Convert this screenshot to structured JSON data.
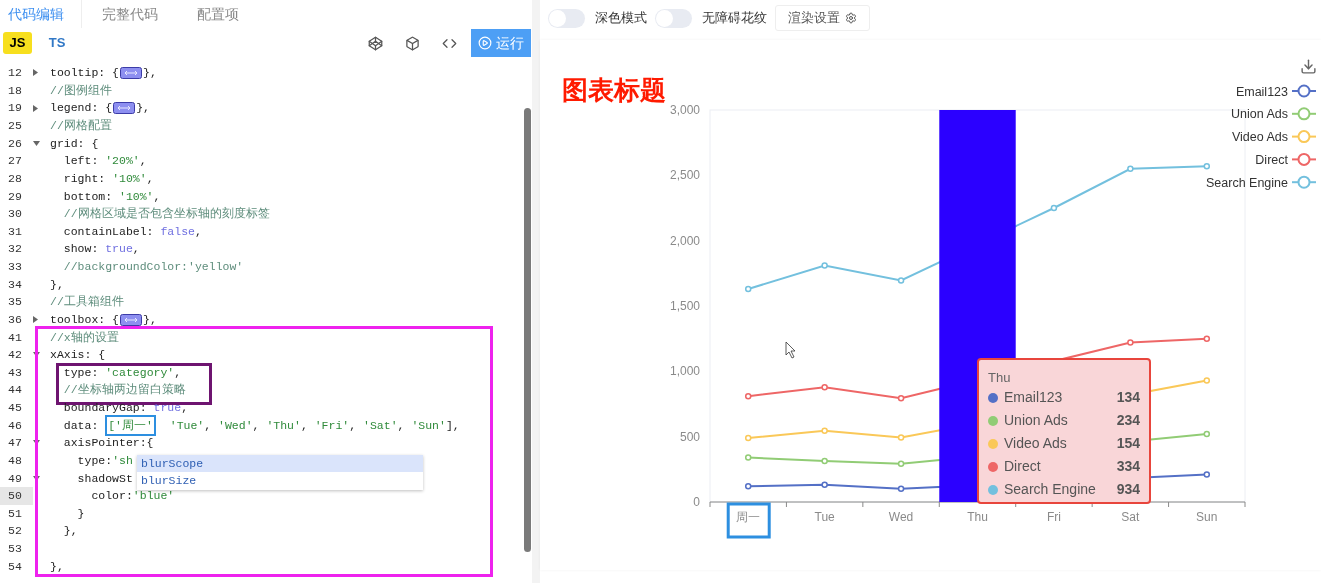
{
  "left_tabs": [
    {
      "label": "代码编辑",
      "selected": true
    },
    {
      "label": "完整代码",
      "selected": false
    },
    {
      "label": "配置项",
      "selected": false
    }
  ],
  "editor": {
    "languages": [
      {
        "label": "JS",
        "selected": true
      },
      {
        "label": "TS",
        "selected": false
      }
    ],
    "run_button": "运行",
    "blocks": [
      {
        "kind": "line",
        "number": "12",
        "fold_open": false,
        "tokens": [
          {
            "kind": "plain",
            "text": "tooltip: {"
          },
          {
            "kind": "fold"
          },
          {
            "kind": "plain",
            "text": "},"
          }
        ]
      },
      {
        "kind": "line",
        "number": "18",
        "tokens": [
          {
            "kind": "comment",
            "text": "//图例组件"
          }
        ]
      },
      {
        "kind": "line",
        "number": "19",
        "fold_open": false,
        "tokens": [
          {
            "kind": "plain",
            "text": "legend: {"
          },
          {
            "kind": "fold"
          },
          {
            "kind": "plain",
            "text": "},"
          }
        ]
      },
      {
        "kind": "line",
        "number": "25",
        "tokens": [
          {
            "kind": "comment",
            "text": "//网格配置"
          }
        ]
      },
      {
        "kind": "line",
        "number": "26",
        "fold_open": true,
        "tokens": [
          {
            "kind": "plain",
            "text": "grid: {"
          }
        ]
      },
      {
        "kind": "line",
        "number": "27",
        "tokens": [
          {
            "kind": "plain",
            "text": "  left: "
          },
          {
            "kind": "string",
            "text": "'20%'"
          },
          {
            "kind": "plain",
            "text": ","
          }
        ]
      },
      {
        "kind": "line",
        "number": "28",
        "tokens": [
          {
            "kind": "plain",
            "text": "  right: "
          },
          {
            "kind": "string",
            "text": "'10%'"
          },
          {
            "kind": "plain",
            "text": ","
          }
        ]
      },
      {
        "kind": "line",
        "number": "29",
        "tokens": [
          {
            "kind": "plain",
            "text": "  bottom: "
          },
          {
            "kind": "string",
            "text": "'10%'"
          },
          {
            "kind": "plain",
            "text": ","
          }
        ]
      },
      {
        "kind": "line",
        "number": "30",
        "tokens": [
          {
            "kind": "comment",
            "text": "  //网格区域是否包含坐标轴的刻度标签"
          }
        ]
      },
      {
        "kind": "line",
        "number": "31",
        "tokens": [
          {
            "kind": "plain",
            "text": "  containLabel: "
          },
          {
            "kind": "keyword",
            "text": "false"
          },
          {
            "kind": "plain",
            "text": ","
          }
        ]
      },
      {
        "kind": "line",
        "number": "32",
        "tokens": [
          {
            "kind": "plain",
            "text": "  show: "
          },
          {
            "kind": "keyword",
            "text": "true"
          },
          {
            "kind": "plain",
            "text": ","
          }
        ]
      },
      {
        "kind": "line",
        "number": "33",
        "tokens": [
          {
            "kind": "comment",
            "text": "  //backgroundColor:'yellow'"
          }
        ]
      },
      {
        "kind": "line",
        "number": "34",
        "tokens": [
          {
            "kind": "plain",
            "text": "},"
          }
        ]
      },
      {
        "kind": "line",
        "number": "35",
        "tokens": [
          {
            "kind": "comment",
            "text": "//工具箱组件"
          }
        ]
      },
      {
        "kind": "line",
        "number": "36",
        "fold_open": false,
        "tokens": [
          {
            "kind": "plain",
            "text": "toolbox: {"
          },
          {
            "kind": "fold"
          },
          {
            "kind": "plain",
            "text": "},"
          }
        ]
      },
      {
        "kind": "frame",
        "color": "#ee22ee",
        "children": [
          {
            "kind": "line",
            "number": "41",
            "tokens": [
              {
                "kind": "comment",
                "text": "//x轴的设置"
              }
            ]
          },
          {
            "kind": "line",
            "number": "42",
            "fold_open": true,
            "tokens": [
              {
                "kind": "plain",
                "text": "xAxis: {"
              }
            ]
          },
          {
            "kind": "frame",
            "color": "#6e1470",
            "children": [
              {
                "kind": "line",
                "number": "43",
                "tokens": [
                  {
                    "kind": "plain",
                    "text": "  type: "
                  },
                  {
                    "kind": "string",
                    "text": "'category'"
                  },
                  {
                    "kind": "plain",
                    "text": ","
                  }
                ]
              },
              {
                "kind": "line",
                "number": "44",
                "tokens": [
                  {
                    "kind": "comment",
                    "text": "  //坐标轴两边留白策略"
                  }
                ]
              }
            ]
          },
          {
            "kind": "line",
            "number": "45",
            "tokens": [
              {
                "kind": "plain",
                "text": "  boundaryGap: "
              },
              {
                "kind": "keyword",
                "text": "true"
              },
              {
                "kind": "plain",
                "text": ","
              }
            ]
          },
          {
            "kind": "line",
            "number": "46",
            "tokens": [
              {
                "kind": "plain",
                "text": "  data: "
              },
              {
                "kind": "string",
                "text": "['周一'",
                "boxed": true
              },
              {
                "kind": "string",
                "text": "  'Tue'"
              },
              {
                "kind": "plain",
                "text": ", "
              },
              {
                "kind": "string",
                "text": "'Wed'"
              },
              {
                "kind": "plain",
                "text": ", "
              },
              {
                "kind": "string",
                "text": "'Thu'"
              },
              {
                "kind": "plain",
                "text": ", "
              },
              {
                "kind": "string",
                "text": "'Fri'"
              },
              {
                "kind": "plain",
                "text": ", "
              },
              {
                "kind": "string",
                "text": "'Sat'"
              },
              {
                "kind": "plain",
                "text": ", "
              },
              {
                "kind": "string",
                "text": "'Sun'"
              },
              {
                "kind": "plain",
                "text": "],"
              }
            ]
          },
          {
            "kind": "line",
            "number": "47",
            "fold_open": true,
            "tokens": [
              {
                "kind": "plain",
                "text": "  axisPointer:{"
              }
            ]
          },
          {
            "kind": "line",
            "number": "48",
            "tokens": [
              {
                "kind": "plain",
                "text": "    type:"
              },
              {
                "kind": "string",
                "text": "'sh"
              }
            ],
            "autocomplete": [
              {
                "label": "blurScope",
                "selected": true
              },
              {
                "label": "blurSize",
                "selected": false
              }
            ]
          },
          {
            "kind": "line",
            "number": "49",
            "fold_open": true,
            "tokens": [
              {
                "kind": "plain",
                "text": "    shadowSt"
              }
            ]
          },
          {
            "kind": "line",
            "number": "50",
            "active": true,
            "tokens": [
              {
                "kind": "plain",
                "text": "      color:"
              },
              {
                "kind": "string",
                "text": "'blue'"
              }
            ]
          },
          {
            "kind": "line",
            "number": "51",
            "tokens": [
              {
                "kind": "plain",
                "text": "    }"
              }
            ]
          },
          {
            "kind": "line",
            "number": "52",
            "tokens": [
              {
                "kind": "plain",
                "text": "  },"
              }
            ]
          },
          {
            "kind": "line",
            "number": "53"
          },
          {
            "kind": "line",
            "number": "54",
            "tokens": [
              {
                "kind": "plain",
                "text": "},"
              }
            ]
          }
        ]
      }
    ]
  },
  "toolbar": {
    "toggles": [
      {
        "label": "深色模式",
        "on": false
      },
      {
        "label": "无障碍花纹",
        "on": false
      }
    ],
    "settings_button": "渲染设置"
  },
  "chart": {
    "first_label_framed": true,
    "chart_data": {
      "type": "line",
      "title": "图表标题",
      "legend": "upper right",
      "categories": [
        "周一",
        "Tue",
        "Wed",
        "Thu",
        "Fri",
        "Sat",
        "Sun"
      ],
      "ylim": [
        0,
        3000
      ],
      "yticks": [
        {
          "value": 0,
          "label": "0"
        },
        {
          "value": 500,
          "label": "500"
        },
        {
          "value": 1000,
          "label": "1,000"
        },
        {
          "value": 1500,
          "label": "1,500"
        },
        {
          "value": 2000,
          "label": "2,000"
        },
        {
          "value": 2500,
          "label": "2,500"
        },
        {
          "value": 3000,
          "label": "3,000"
        }
      ],
      "series": [
        {
          "name": "Email123",
          "color": "#5470c6",
          "marker": "o",
          "values": [
            120,
            132,
            101,
            null,
            null,
            null,
            210
          ]
        },
        {
          "name": "Union Ads",
          "color": "#91cc75",
          "marker": "o",
          "values": [
            340,
            314,
            292,
            null,
            null,
            null,
            520
          ]
        },
        {
          "name": "Video Ads",
          "color": "#fac858",
          "marker": "o",
          "values": [
            490,
            546,
            493,
            null,
            null,
            null,
            930
          ]
        },
        {
          "name": "Direct",
          "color": "#ee6666",
          "marker": "o",
          "values": [
            810,
            878,
            794,
            null,
            null,
            1220,
            1250
          ]
        },
        {
          "name": "Search Engine",
          "color": "#73c0de",
          "marker": "o",
          "values": [
            1630,
            1810,
            1695,
            null,
            2250,
            2550,
            2570
          ]
        }
      ],
      "bands": [
        {
          "axis": "x",
          "from": "Thu",
          "to": "Thu",
          "color": "#2b00ff"
        }
      ]
    },
    "tooltip": {
      "title": "Thu",
      "rows": [
        {
          "name": "Email123",
          "value": "134",
          "color": "#5470c6"
        },
        {
          "name": "Union Ads",
          "value": "234",
          "color": "#91cc75"
        },
        {
          "name": "Video Ads",
          "value": "154",
          "color": "#fac858"
        },
        {
          "name": "Direct",
          "value": "334",
          "color": "#ee6666"
        },
        {
          "name": "Search Engine",
          "value": "934",
          "color": "#73c0de"
        }
      ]
    }
  }
}
